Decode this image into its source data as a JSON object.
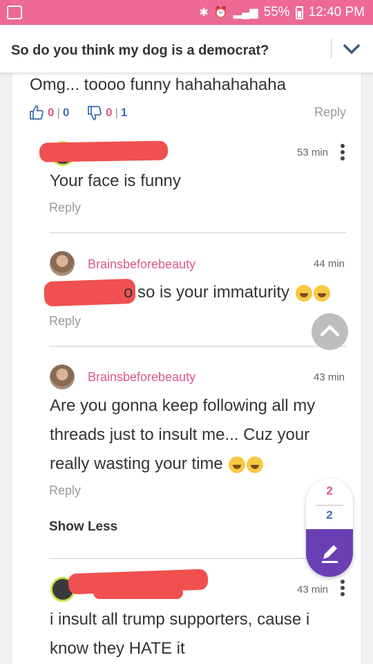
{
  "status": {
    "battery": "55%",
    "time": "12:40 PM"
  },
  "header": {
    "title": "So do you think my dog is a democrat?"
  },
  "top_comment": {
    "text": "Omg... toooo funny hahahahahaha",
    "up_count": "0",
    "up_reply": "0",
    "down_count": "0",
    "down_reply": "1",
    "reply": "Reply"
  },
  "replies": [
    {
      "time": "53 min",
      "text": "Your face is funny",
      "reply": "Reply"
    },
    {
      "user": "Brainsbeforebeauty",
      "time": "44 min",
      "text": "o so is your immaturity",
      "reply": "Reply"
    },
    {
      "user": "Brainsbeforebeauty",
      "time": "43 min",
      "text_line1": "Are you gonna keep following all my",
      "text_line2": "threads just to insult me... Cuz your",
      "text_line3": "really wasting your time",
      "reply": "Reply"
    },
    {
      "time": "43 min",
      "text_line1": "i insult all trump supporters, cause i",
      "text_line2": "know they HATE it"
    }
  ],
  "show_less": "Show Less",
  "counter": {
    "top": "2",
    "bottom": "2"
  },
  "colors": {
    "status_bar": "#ec6a94",
    "username": "#e0558d",
    "accent": "#6b3fb4",
    "count_blue": "#3b6fb0"
  }
}
